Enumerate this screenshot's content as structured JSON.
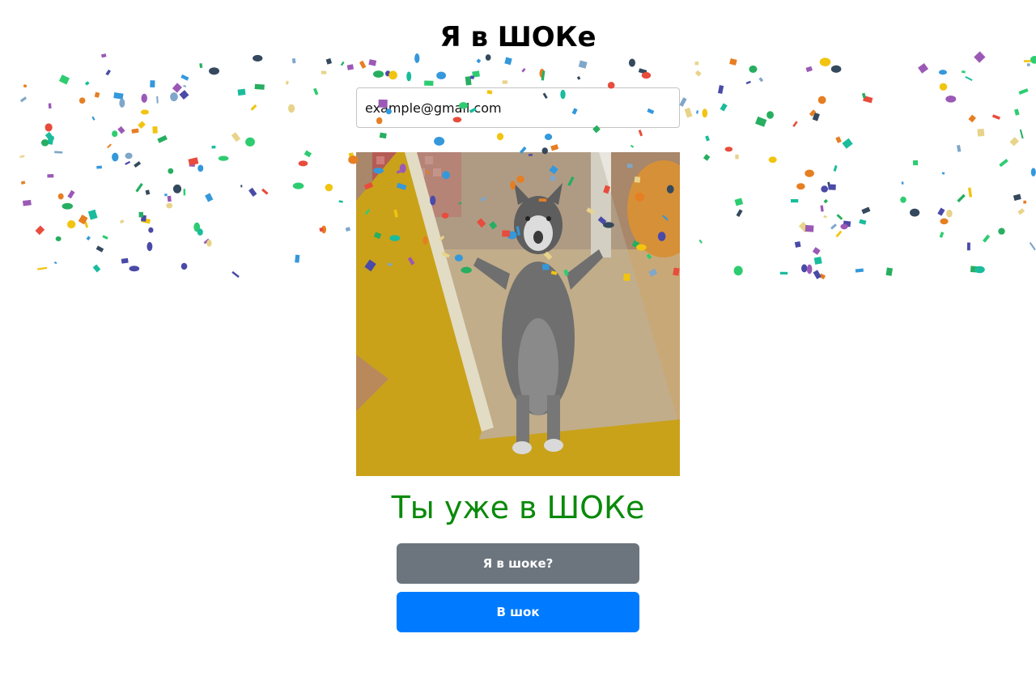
{
  "header": {
    "title": "Я в ШОКе"
  },
  "form": {
    "email_value": "example@gmail.com"
  },
  "image": {
    "alt": "cat-gif"
  },
  "status": {
    "text": "Ты уже в ШОКе",
    "color": "#0a8a0a"
  },
  "buttons": {
    "check_label": "Я в шоке?",
    "shock_label": "В шок"
  },
  "colors": {
    "secondary_button": "#6c757d",
    "primary_button": "#007bff",
    "confetti": [
      "#2ecc71",
      "#e67e22",
      "#3498db",
      "#9b59b6",
      "#e74c3c",
      "#f1c40f",
      "#1abc9c",
      "#34495e",
      "#e8d38a",
      "#7fa7c9",
      "#4a4aa8",
      "#27ae60"
    ]
  }
}
